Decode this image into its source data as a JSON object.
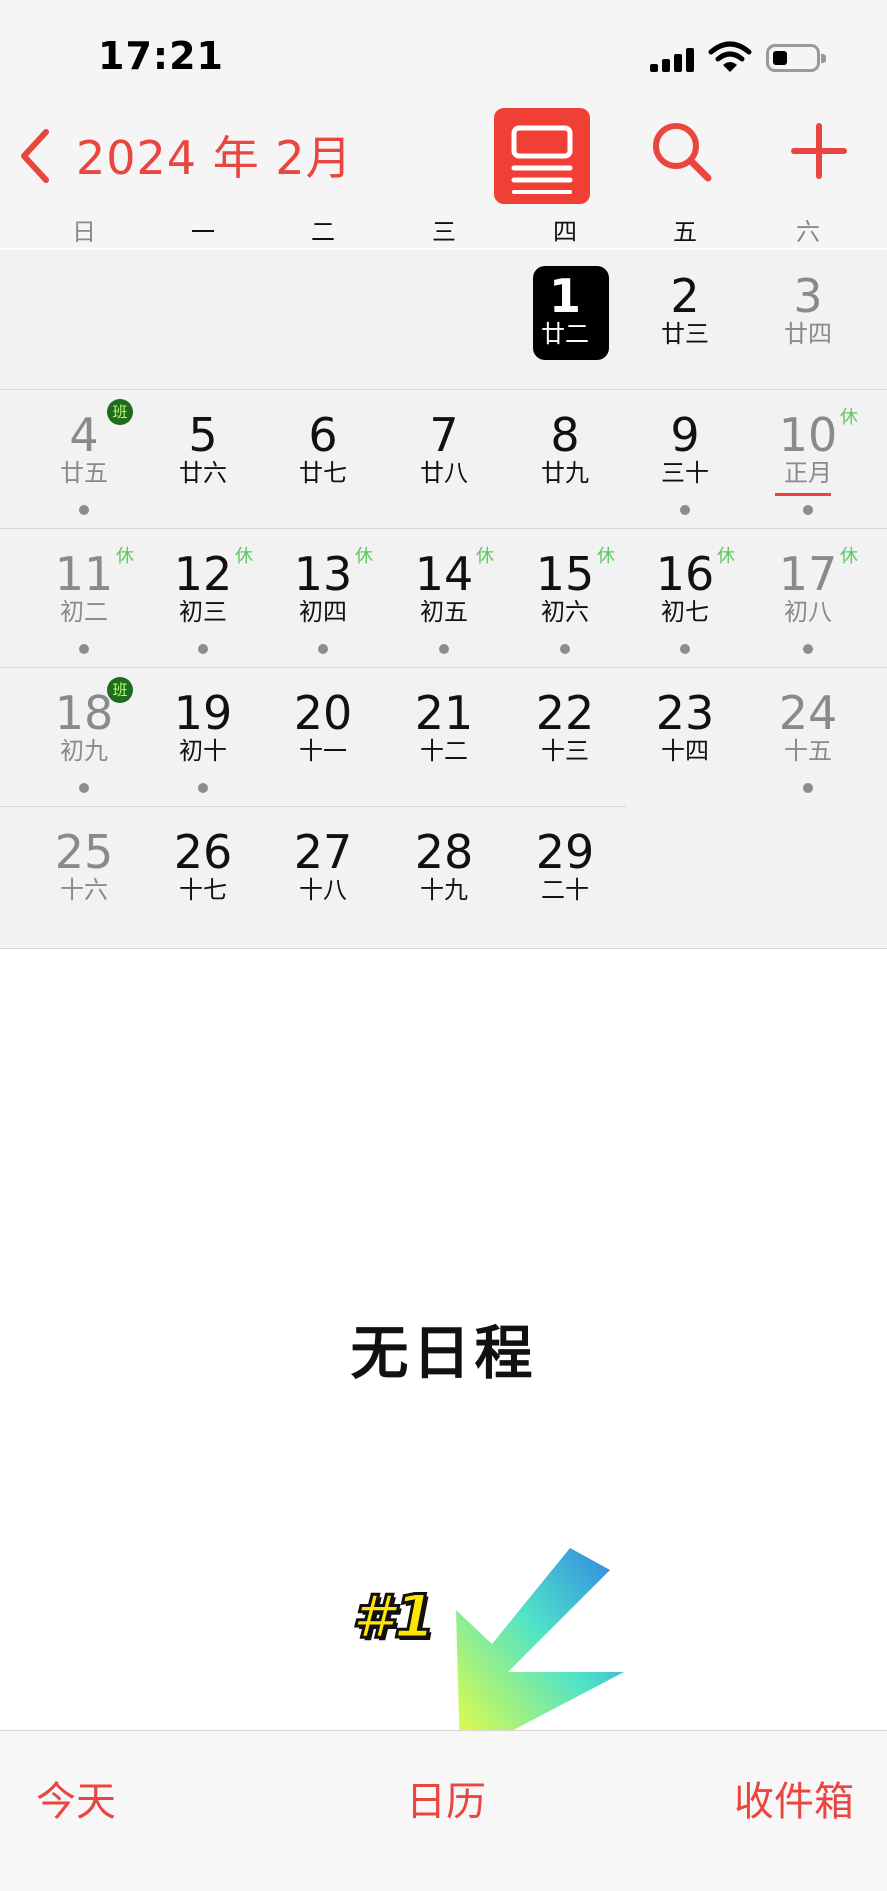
{
  "status_bar": {
    "time": "17:21"
  },
  "nav": {
    "title": "2024 年 2月"
  },
  "weekdays": [
    "日",
    "一",
    "二",
    "三",
    "四",
    "五",
    "六"
  ],
  "calendar": {
    "weeks": [
      [
        null,
        null,
        null,
        null,
        {
          "day": "1",
          "lunar": "廿二",
          "today": true,
          "dot": false
        },
        {
          "day": "2",
          "lunar": "廿三",
          "dot": false
        },
        {
          "day": "3",
          "lunar": "廿四",
          "dot": false
        }
      ],
      [
        {
          "day": "4",
          "lunar": "廿五",
          "dot": true,
          "badge": "班"
        },
        {
          "day": "5",
          "lunar": "廿六",
          "dot": false
        },
        {
          "day": "6",
          "lunar": "廿七",
          "dot": false
        },
        {
          "day": "7",
          "lunar": "廿八",
          "dot": false
        },
        {
          "day": "8",
          "lunar": "廿九",
          "dot": false
        },
        {
          "day": "9",
          "lunar": "三十",
          "dot": true
        },
        {
          "day": "10",
          "lunar": "正月",
          "dot": true,
          "badge": "休",
          "lunar_highlight": true
        }
      ],
      [
        {
          "day": "11",
          "lunar": "初二",
          "dot": true,
          "badge": "休"
        },
        {
          "day": "12",
          "lunar": "初三",
          "dot": true,
          "badge": "休"
        },
        {
          "day": "13",
          "lunar": "初四",
          "dot": true,
          "badge": "休"
        },
        {
          "day": "14",
          "lunar": "初五",
          "dot": true,
          "badge": "休"
        },
        {
          "day": "15",
          "lunar": "初六",
          "dot": true,
          "badge": "休"
        },
        {
          "day": "16",
          "lunar": "初七",
          "dot": true,
          "badge": "休"
        },
        {
          "day": "17",
          "lunar": "初八",
          "dot": true,
          "badge": "休"
        }
      ],
      [
        {
          "day": "18",
          "lunar": "初九",
          "dot": true,
          "badge": "班"
        },
        {
          "day": "19",
          "lunar": "初十",
          "dot": true
        },
        {
          "day": "20",
          "lunar": "十一",
          "dot": false
        },
        {
          "day": "21",
          "lunar": "十二",
          "dot": false
        },
        {
          "day": "22",
          "lunar": "十三",
          "dot": false
        },
        {
          "day": "23",
          "lunar": "十四",
          "dot": false
        },
        {
          "day": "24",
          "lunar": "十五",
          "dot": true
        }
      ],
      [
        {
          "day": "25",
          "lunar": "十六",
          "dot": false
        },
        {
          "day": "26",
          "lunar": "十七",
          "dot": false
        },
        {
          "day": "27",
          "lunar": "十八",
          "dot": false
        },
        {
          "day": "28",
          "lunar": "十九",
          "dot": false
        },
        {
          "day": "29",
          "lunar": "二十",
          "dot": false
        },
        null,
        null
      ]
    ]
  },
  "events": {
    "empty_text": "无日程"
  },
  "overlay": {
    "tag": "#1"
  },
  "tabbar": {
    "today": "今天",
    "calendars": "日历",
    "inbox": "收件箱"
  },
  "colors": {
    "accent": "#e8463e",
    "weekend_text": "#8a8a8a",
    "weekday_text": "#111111",
    "rest_badge": "#5cc85c",
    "work_badge_bg": "#1f6b1f",
    "work_badge_text": "#b6ff6a"
  }
}
